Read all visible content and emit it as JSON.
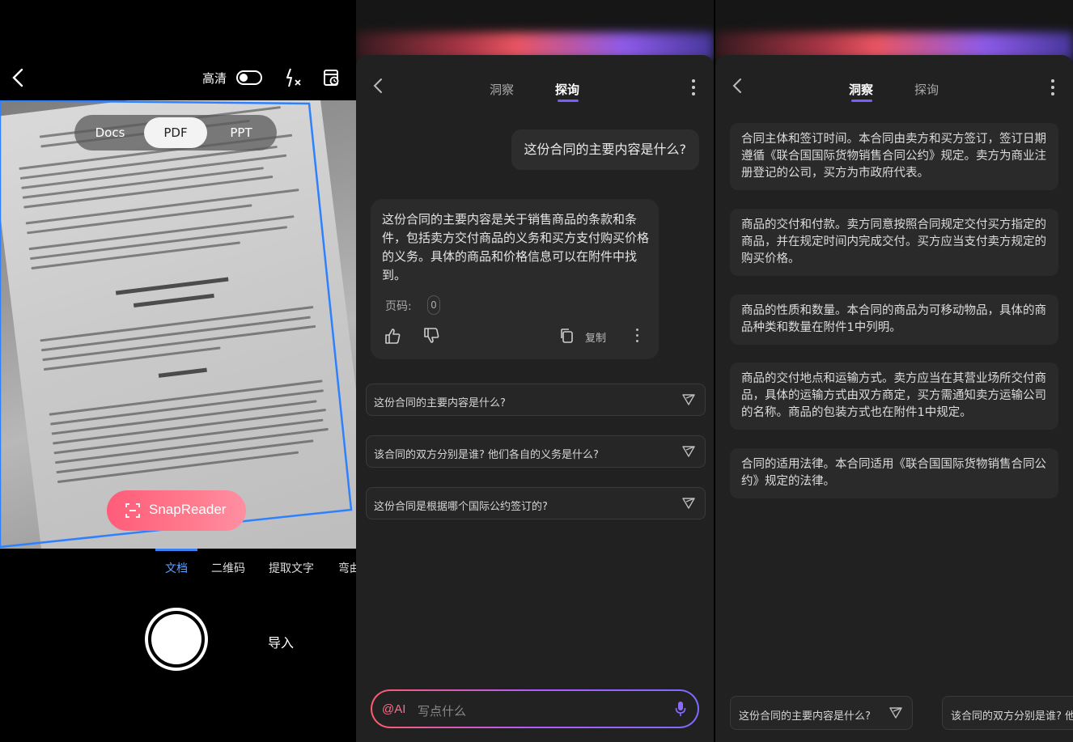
{
  "camera": {
    "hd_label": "高清",
    "modes": [
      "Docs",
      "PDF",
      "PPT"
    ],
    "selected_mode": "PDF",
    "snapreader_label": "SnapReader",
    "scan_tabs": [
      "文档",
      "二维码",
      "提取文字",
      "弯曲"
    ],
    "active_scan_tab": "文档",
    "import_label": "导入"
  },
  "chat": {
    "tabs": [
      "洞察",
      "探询"
    ],
    "active_tab": "探询",
    "user_question": "这份合同的主要内容是什么?",
    "ai_answer": "这份合同的主要内容是关于销售商品的条款和条件，包括卖方交付商品的义务和买方支付购买价格的义务。具体的商品和价格信息可以在附件中找到。",
    "page_ref_label": "页码:",
    "page_ref_value": "0",
    "copy_label": "复制",
    "suggestions": [
      "这份合同的主要内容是什么?",
      "该合同的双方分别是谁? 他们各自的义务是什么?",
      "这份合同是根据哪个国际公约签订的?"
    ],
    "input_prefix": "@AI",
    "input_placeholder": "写点什么"
  },
  "insight": {
    "tabs": [
      "洞察",
      "探询"
    ],
    "active_tab": "洞察",
    "cards": [
      "合同主体和签订时间。本合同由卖方和买方签订，签订日期遵循《联合国国际货物销售合同公约》规定。卖方为商业注册登记的公司，买方为市政府代表。",
      "商品的交付和付款。卖方同意按照合同规定交付买方指定的商品，并在规定时间内完成交付。买方应当支付卖方规定的购买价格。",
      "商品的性质和数量。本合同的商品为可移动物品，具体的商品种类和数量在附件1中列明。",
      "商品的交付地点和运输方式。卖方应当在其营业场所交付商品，具体的运输方式由双方商定，买方需通知卖方运输公司的名称。商品的包装方式也在附件1中规定。",
      "合同的适用法律。本合同适用《联合国国际货物销售合同公约》规定的法律。"
    ],
    "bottom_suggestions": [
      "这份合同的主要内容是什么?",
      "该合同的双方分别是谁? 他"
    ]
  },
  "colors": {
    "accent_purple": "#7b5cff",
    "snap_pink": "#ff6b80",
    "scan_blue": "#3b82f6"
  }
}
